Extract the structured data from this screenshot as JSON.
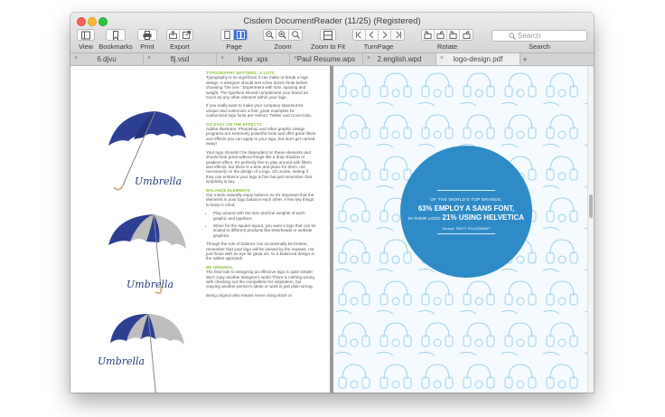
{
  "window": {
    "title": "Cisdem DocumentReader (11/25) (Registered)"
  },
  "toolbar": {
    "view": "View",
    "bookmarks": "Bookmarks",
    "print": "Print",
    "export": "Export",
    "page": "Page",
    "zoom": "Zoom",
    "zoom_to_fit": "Zoom to Fit",
    "turn_page": "TurnPage",
    "rotate": "Rotate",
    "search_label": "Search",
    "search_placeholder": "Search"
  },
  "tabs": [
    {
      "label": "6.djvu",
      "active": false
    },
    {
      "label": "flj.vsd",
      "active": false
    },
    {
      "label": "How .xps",
      "active": false
    },
    {
      "label": "Paul Resume.wps",
      "active": false
    },
    {
      "label": "2.english.wpd",
      "active": false
    },
    {
      "label": "logo-design.pdf",
      "active": true
    }
  ],
  "tab_close_glyph": "×",
  "tab_add_glyph": "+",
  "left_page": {
    "umbrella_word": "Umbrella",
    "umbrella_colors": {
      "dark": "#2c3f93",
      "grey": "#bdbdbd",
      "handle": "#d4b483"
    },
    "heading_color": "#8cbf3f",
    "sections": [
      {
        "heading": "TYPOGRAPHY MATTERS...A LOT!!",
        "paragraphs": [
          "Typography is so significant it can make or break a logo design. A designer should test a few dozen fonts before choosing \"the one.\" Experiment with size, spacing and weight. The typeface should complement your brand as much as any other element within your logo.",
          "If you really want to make your company standout be unique and customize a font; great examples for customized logo fonts are Yahoo!, Twitter and Coca-Cola."
        ]
      },
      {
        "heading": "GO EASY ON THE EFFECTS",
        "paragraphs": [
          "Adobe Illustrator, Photoshop and other graphic design programs are extremely powerful tools and offer great filters and effects you can apply to your logo, but don't get carried away!",
          "Your logo shouldn't be dependent on these elements and should look great without things like a drop shadow or gradient effect. It's perfectly fine to play around with filters and effects, but there is a time and place for them, not necessarily on the design of a logo. Of course, seeing if they can enhance your logo is fine but just remember that simplicity is key."
        ]
      },
      {
        "heading": "BALANCE ELEMENTS",
        "paragraphs": [
          "Our minds naturally enjoy balance so it's important that the elements in your logo balance each other. A few key things to keep in mind:"
        ],
        "bullets": [
          "Play around with the size and line weights of each graphic and typeface",
          "Strive for the square layout, you want a logo that can be scaled to different products like letterheads or website graphics"
        ],
        "after": [
          "Though the rule of balance can occasionally be broken, remember that your logo will be viewed by the masses, not just those with an eye for great art, so a balanced design is the safest approach."
        ]
      },
      {
        "heading": "BE ORIGINAL",
        "paragraphs": [
          "The final rule to designing an effective logo is quite simple; don't copy another designer's work! There is nothing wrong with checking out the competition for inspiration, but copying another person's ideas or work is just plain wrong.",
          "Being original also means never using stock or"
        ]
      }
    ]
  },
  "right_page": {
    "background_color": "#f4fafd",
    "pattern_color": "#9fd2ec",
    "circle_color": "#2e8bc8",
    "line1": "OF THE WORLD'S TOP BRANDS,",
    "line2": "63% EMPLOY A SANS FONT,",
    "line3_prefix": "IN THEIR LOGO",
    "line3_main": "21% USING HELVETICA",
    "source": "Source: TASTY PLACEMENT"
  }
}
